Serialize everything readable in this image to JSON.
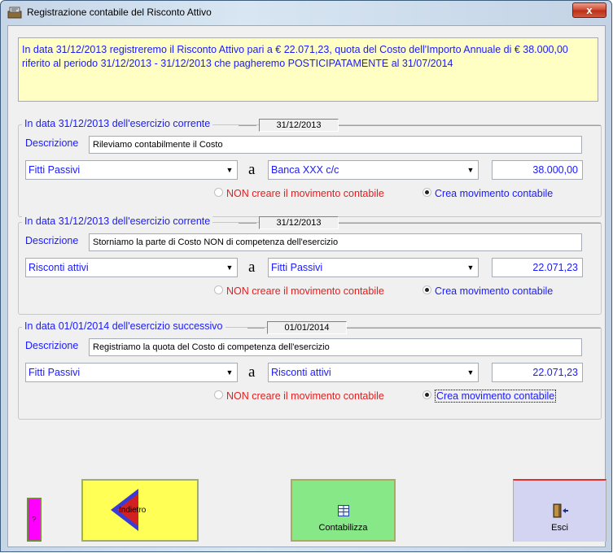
{
  "window": {
    "title": "Registrazione contabile del Risconto Attivo",
    "close_label": "x"
  },
  "info_text": "In data 31/12/2013 registreremo il Risconto Attivo pari a € 22.071,23, quota del Costo dell'Importo Annuale di € 38.000,00 riferito al periodo 31/12/2013 - 31/12/2013 che pagheremo POSTICIPATAMENTE al 31/07/2014",
  "entries": [
    {
      "legend": "In data 31/12/2013 dell'esercizio corrente",
      "date": "31/12/2013",
      "description_label": "Descrizione",
      "description": "Rileviamo contabilmente il Costo",
      "debit_account": "Fitti Passivi",
      "a_label": "a",
      "credit_account": "Banca XXX c/c",
      "amount": "38.000,00",
      "radio_non": "NON creare il movimento contabile",
      "radio_crea": "Crea movimento contabile"
    },
    {
      "legend": "In data 31/12/2013 dell'esercizio corrente",
      "date": "31/12/2013",
      "description_label": "Descrizione",
      "description": "Storniamo la parte di Costo NON di competenza dell'esercizio",
      "debit_account": "Risconti attivi",
      "a_label": "a",
      "credit_account": "Fitti Passivi",
      "amount": "22.071,23",
      "radio_non": "NON creare il movimento contabile",
      "radio_crea": "Crea movimento contabile"
    },
    {
      "legend": "In data 01/01/2014 dell'esercizio successivo",
      "date": "01/01/2014",
      "description_label": "Descrizione",
      "description": "Registriamo la quota del Costo di competenza dell'esercizio",
      "debit_account": "Fitti Passivi",
      "a_label": "a",
      "credit_account": "Risconti attivi",
      "amount": "22.071,23",
      "radio_non": "NON creare il movimento contabile",
      "radio_crea": "Crea movimento contabile"
    }
  ],
  "buttons": {
    "help": "?",
    "back": "Indietro",
    "post": "Contabilizza",
    "exit": "Esci"
  },
  "colors": {
    "label_blue": "#1a1aff",
    "warning_red": "#e31e1e",
    "info_bg": "#ffffc3"
  }
}
